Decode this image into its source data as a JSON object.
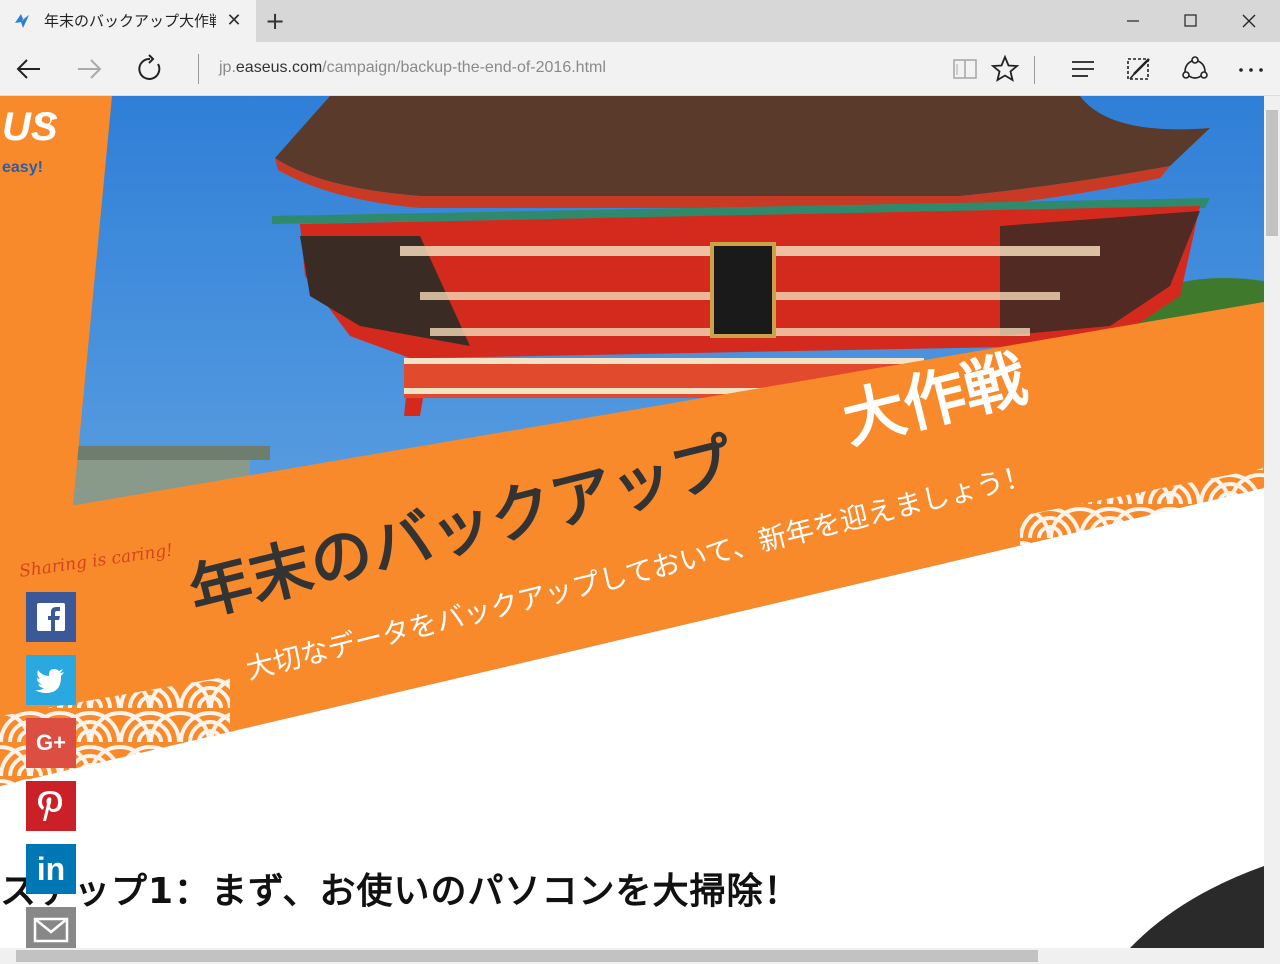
{
  "browser": {
    "tab_title": "年末のバックアップ大作戦",
    "tab_close": "✕",
    "new_tab": "+",
    "url_prefix": "jp.",
    "url_host": "easeus.com",
    "url_path": "/campaign/backup-the-end-of-2016.html"
  },
  "banner": {
    "logo_tail": "US",
    "logo_tagline": "easy!",
    "title_main": "年末のバックアップ",
    "title_accent": "大作戦",
    "subtitle": "大切なデータをバックアップしておいて、新年を迎えましょう！"
  },
  "share": {
    "caption": "Sharing is caring!",
    "google_plus": "G+",
    "linkedin": "in"
  },
  "content": {
    "step_heading": "ステップ1：まず、お使いのパソコンを大掃除！"
  },
  "colors": {
    "orange": "#f98a2b",
    "sky": "#4a90d9",
    "temple_red": "#d42a1d",
    "roof": "#5a3a2a"
  }
}
